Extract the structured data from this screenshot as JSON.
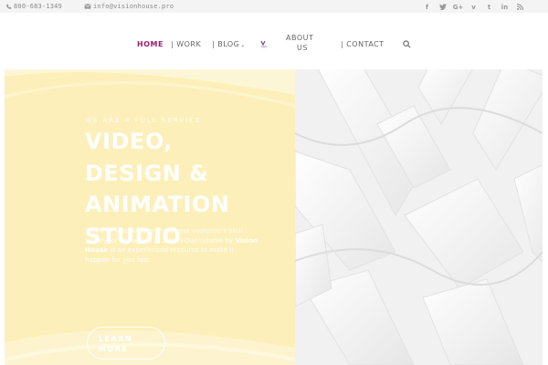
{
  "topbar": {
    "phone": "800-683-1349",
    "email": "info@visionhouse.pro",
    "socials": [
      "facebook-icon",
      "twitter-icon",
      "google-plus-icon",
      "vimeo-icon",
      "tumblr-icon",
      "linkedin-icon",
      "rss-icon"
    ]
  },
  "nav": {
    "home": "HOME",
    "work": "WORK",
    "blog": "BLOG",
    "about_line1": "ABOUT",
    "about_line2": "US",
    "contact": "CONTACT",
    "separator": "|",
    "active_color": "#9c1f70"
  },
  "hero": {
    "eyebrow": "WE ARE A FULL SERVICE",
    "headline": [
      "VIDEO,",
      "DESIGN &",
      "ANIMATION",
      "STUDIO"
    ],
    "description_pre": "Whether you want to show your customers your facility, or showcase or a Non-Overridable by",
    "description_brand": "Vision House",
    "description_post": "is an experienced resource to make it happen for you fast.",
    "cta": [
      "LEARN",
      "MORE"
    ],
    "left_bg": "#fcefb9",
    "right_bg": "#f3f3f3"
  }
}
